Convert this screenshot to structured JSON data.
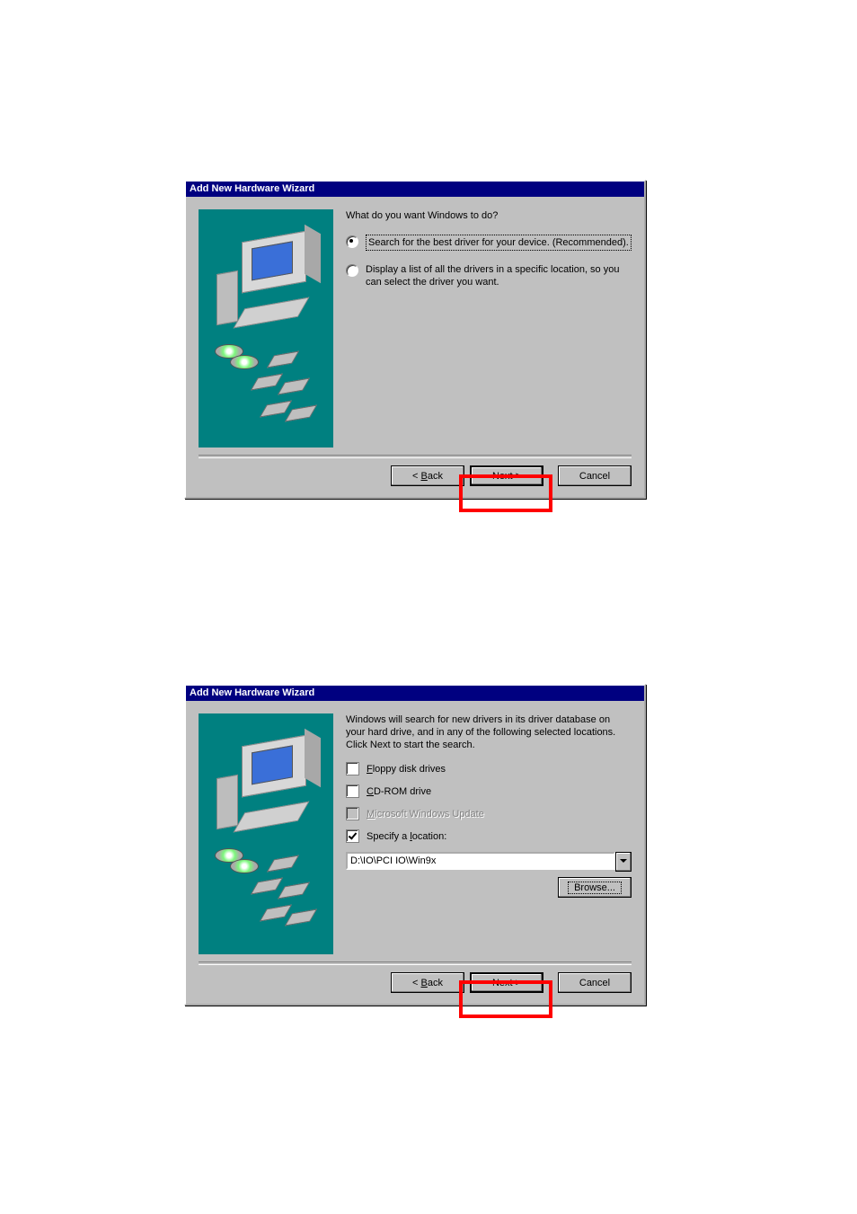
{
  "dialog1": {
    "title": "Add New Hardware Wizard",
    "prompt": "What do you want Windows to do?",
    "option1": "Search for the best driver for your device. (Recommended).",
    "option2": "Display a list of all the drivers in a specific location, so you can select the driver you want.",
    "back": "< Back",
    "next": "Next >",
    "cancel": "Cancel"
  },
  "dialog2": {
    "title": "Add New Hardware Wizard",
    "description": "Windows will search for new drivers in its driver database on your hard drive, and in any of the following selected locations. Click Next to start the search.",
    "floppy": "Floppy disk drives",
    "cdrom": "CD-ROM drive",
    "msupdate": "Microsoft Windows Update",
    "specify": "Specify a location:",
    "path": "D:\\IO\\PCI IO\\Win9x",
    "browse": "Browse...",
    "back": "< Back",
    "next": "Next >",
    "cancel": "Cancel"
  }
}
